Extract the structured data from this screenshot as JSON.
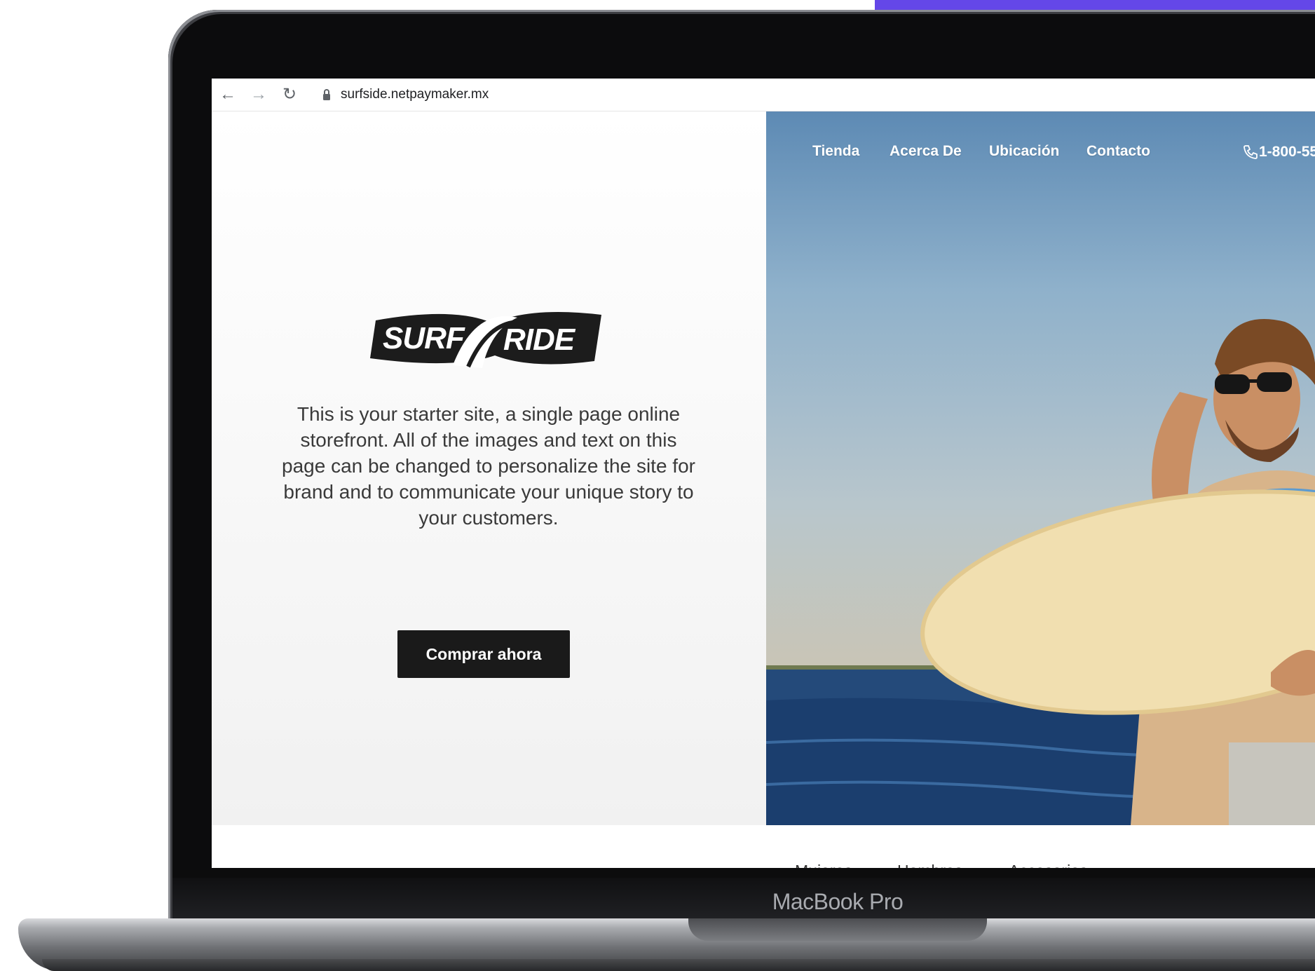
{
  "browser": {
    "url": "surfside.netpaymaker.mx",
    "icons": [
      "back-arrow-icon",
      "forward-arrow-icon",
      "reload-icon",
      "lock-icon"
    ]
  },
  "hero": {
    "logo_text": "SURF RIDE",
    "description": "This is your starter site, a single page online storefront. All of the images and text on this page can be changed to personalize the site for brand and to communicate your unique story to your customers.",
    "cta_label": "Comprar ahora"
  },
  "nav": {
    "items": [
      {
        "label": "Tienda"
      },
      {
        "label": "Acerca De"
      },
      {
        "label": "Ubicación"
      },
      {
        "label": "Contacto"
      }
    ],
    "phone": "1-800-55"
  },
  "categories": [
    {
      "label": "Mujeres"
    },
    {
      "label": "Hombres"
    },
    {
      "label": "Accesorios"
    }
  ],
  "device": {
    "label": "MacBook Pro"
  },
  "colors": {
    "accent": "#6447e8",
    "button_bg": "#1a1a1a",
    "button_text": "#ffffff",
    "panel_bg": "#f7f7f7"
  }
}
